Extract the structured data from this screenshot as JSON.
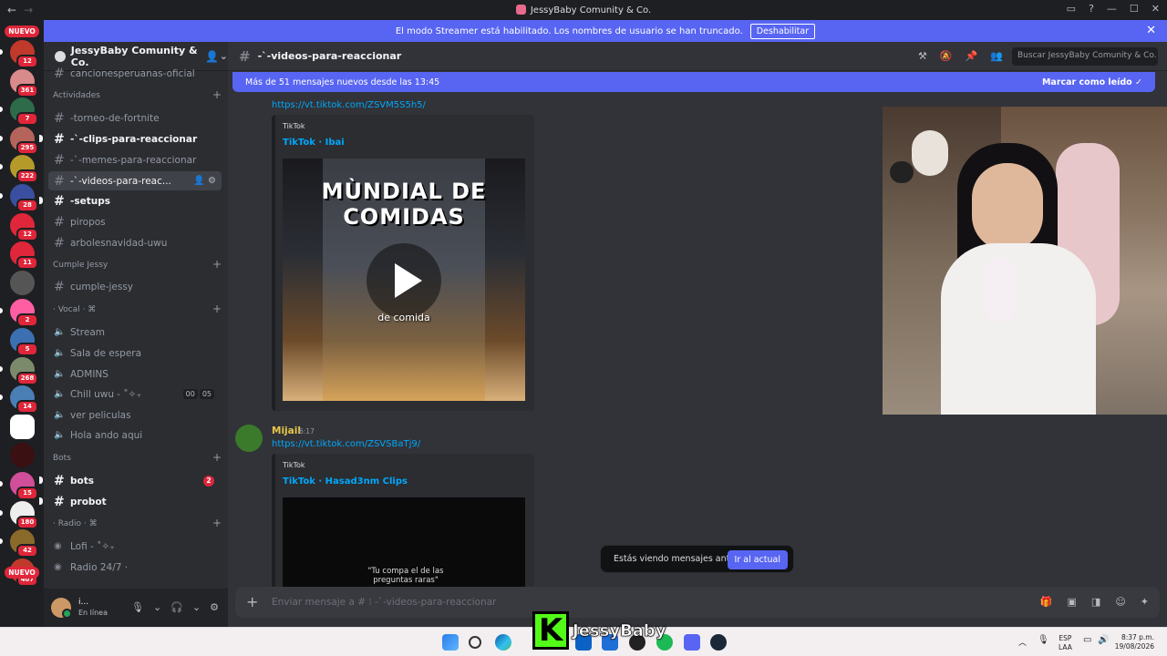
{
  "window": {
    "title": "JessyBaby Comunity & Co."
  },
  "banner": {
    "text": "El modo Streamer está habilitado. Los nombres de usuario se han truncado.",
    "button": "Deshabilitar"
  },
  "servers": {
    "top_badge": "NUEVO",
    "bottom_badge": "NUEVO",
    "items": [
      {
        "badge": "12",
        "color": "#c0392b"
      },
      {
        "badge": "361",
        "color": "#d98a8a"
      },
      {
        "badge": "7",
        "color": "#2d6b4a"
      },
      {
        "badge": "295",
        "color": "#b4645a"
      },
      {
        "badge": "222",
        "color": "#b59a2a"
      },
      {
        "badge": "28",
        "color": "#3b4fa0"
      },
      {
        "badge": "12",
        "color": "#e0263a"
      },
      {
        "badge": "11",
        "color": "#e0263a"
      },
      {
        "badge": "",
        "color": "#555"
      },
      {
        "badge": "2",
        "color": "#ff5fa2"
      },
      {
        "badge": "5",
        "color": "#3d6fb3"
      },
      {
        "badge": "268",
        "color": "#7b8a6a"
      },
      {
        "badge": "14",
        "color": "#4a7fb5"
      },
      {
        "badge": "",
        "color": "#ffffff"
      },
      {
        "badge": "",
        "color": "#3a1012"
      },
      {
        "badge": "15",
        "color": "#d04e9a"
      },
      {
        "badge": "180",
        "color": "#eeeeee"
      },
      {
        "badge": "42",
        "color": "#8a6a2a"
      },
      {
        "badge": "407",
        "color": "#c0392b"
      }
    ]
  },
  "sidebar": {
    "server_name": "JessyBaby Comunity & Co.",
    "channels": [
      {
        "name": "cancionesperuanas-oficial",
        "type": "text"
      },
      {
        "cat": "Actividades"
      },
      {
        "name": "-torneo-de-fortnite",
        "type": "text"
      },
      {
        "name": "-`-clips-para-reaccionar",
        "type": "text",
        "unread": true
      },
      {
        "name": "-`-memes-para-reaccionar",
        "type": "text"
      },
      {
        "name": "-`-videos-para-reac...",
        "type": "text",
        "active": true
      },
      {
        "name": "-setups",
        "type": "text",
        "unread": true
      },
      {
        "name": "piropos",
        "type": "text"
      },
      {
        "name": "arbolesnavidad-uwu",
        "type": "text"
      },
      {
        "cat": "Cumple Jessy"
      },
      {
        "name": "cumple-jessy",
        "type": "text"
      },
      {
        "cat": "· Vocal · ⌘"
      },
      {
        "name": "Stream",
        "type": "voice"
      },
      {
        "name": "Sala de espera",
        "type": "voice"
      },
      {
        "name": "ADMINS",
        "type": "voice"
      },
      {
        "name": "Chill uwu - ˚✧₊",
        "type": "voice",
        "counts": [
          "00",
          "05"
        ]
      },
      {
        "name": "ver peliculas",
        "type": "voice"
      },
      {
        "name": "Hola ando aqui",
        "type": "voice"
      },
      {
        "cat": "Bots"
      },
      {
        "name": "bots",
        "type": "text",
        "unread": true,
        "badge": "2"
      },
      {
        "name": "probot",
        "type": "text",
        "unread": true
      },
      {
        "cat": "· Radio · ⌘"
      },
      {
        "name": "Lofi - ˚✧₊",
        "type": "stage"
      },
      {
        "name": "Radio 24/7 ·",
        "type": "stage"
      }
    ]
  },
  "user": {
    "name": "i...",
    "status": "En línea"
  },
  "chat": {
    "channel_name": "-`-videos-para-reaccionar",
    "search_placeholder": "Buscar JessyBaby Comunity & Co.",
    "new_messages": "Más de 51 mensajes nuevos desde las 13:45",
    "mark_read": "Marcar como leído",
    "msg1": {
      "link": "https://vt.tiktok.com/ZSVM5S5h5/",
      "provider": "TikTok",
      "embed_title": "TikTok · Ibai",
      "video_headline1": "MÙNDIAL DE",
      "video_headline2": "COMIDAS",
      "video_caption": "de comida"
    },
    "msg2": {
      "author": "Mijail",
      "time": "6:17",
      "link": "https://vt.tiktok.com/ZSVSBaTj9/",
      "provider": "TikTok",
      "embed_title": "TikTok · Hasad3nm Clips",
      "video_caption": "\"Tu compa el de las preguntas raras\""
    },
    "old_messages": "Estás viendo mensajes antiguos",
    "jump_button": "Ir al actual",
    "composer_placeholder": "Enviar mensaje a # ⁝ -`-videos-para-reaccionar"
  },
  "taskbar": {
    "lang1": "ESP",
    "lang2": "LAA",
    "time": "8:37 p.m.",
    "date": "19/08/2026",
    "overlay": "JessyBaby"
  },
  "colors": {
    "accent": "#5865f2",
    "danger": "#e0263a",
    "link": "#00a8fc"
  }
}
